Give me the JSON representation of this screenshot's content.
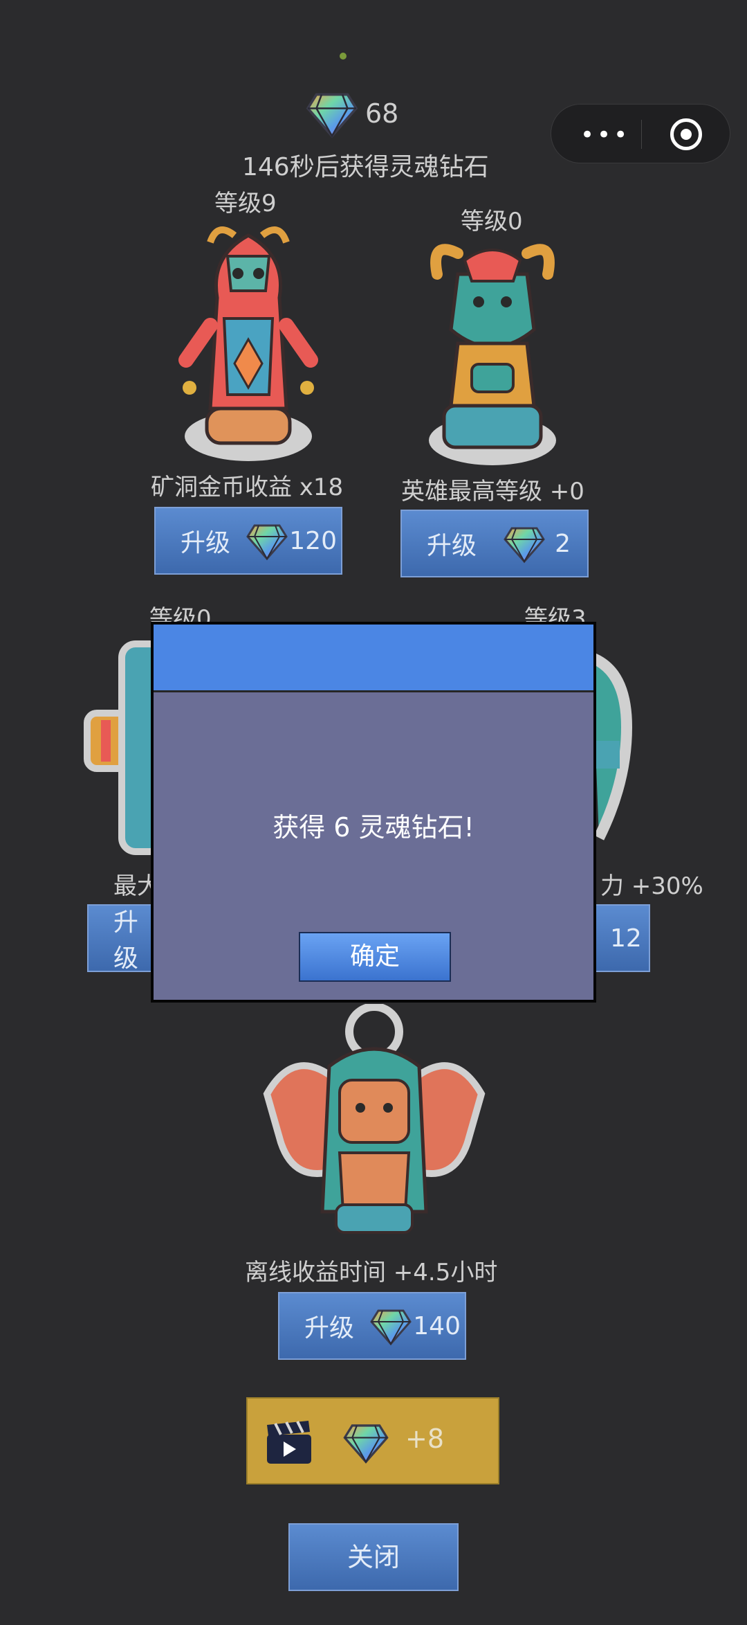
{
  "top": {
    "diamond_count": "68",
    "timer_text": "146秒后获得灵魂钻石"
  },
  "capsule": {
    "more_icon": "more-dots-icon",
    "close_icon": "target-icon"
  },
  "totems": [
    {
      "level": "等级9",
      "effect": "矿洞金币收益 x18",
      "button_label": "升级",
      "cost": "120"
    },
    {
      "level": "等级0",
      "effect": "英雄最高等级 +0",
      "button_label": "升级",
      "cost": "2"
    },
    {
      "level": "等级0",
      "effect": "最大",
      "button_label": "升级",
      "cost": ""
    },
    {
      "level": "等级3",
      "effect": "力 +30%",
      "button_label": "",
      "cost": "12"
    },
    {
      "level": "",
      "effect": "离线收益时间 +4.5小时",
      "button_label": "升级",
      "cost": "140"
    }
  ],
  "dialog": {
    "message": "获得 6 灵魂钻石!",
    "confirm_label": "确定"
  },
  "video_reward": {
    "amount": "+8"
  },
  "close_label": "关闭",
  "colors": {
    "background": "#2b2b2d",
    "button_blue": "#4a78bf",
    "dialog_header": "#4b86e4",
    "dialog_body": "#6b6e96",
    "video_gold": "#c9a13c"
  }
}
